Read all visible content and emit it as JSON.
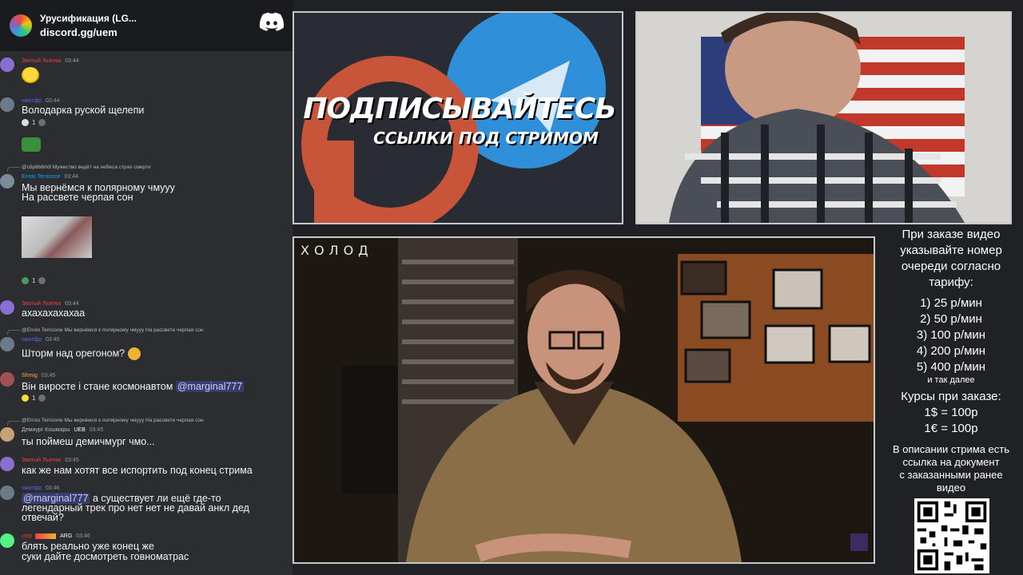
{
  "widget": {
    "server_name": "Урусификация (LG...",
    "invite": "discord.gg/uem"
  },
  "messages": [
    {
      "user": "Звитый Львтюк",
      "time": "03:44",
      "user_color": "#f23f43",
      "body": ""
    },
    {
      "user": "чмотфр",
      "time": "03:44",
      "user_color": "#5865f2",
      "body": "Володарка руской щелепи",
      "reaction_count": "1"
    },
    {
      "reply_text": "@c8p8b8rk8 Мужество ведёт на небеса страх смерти",
      "user": "Ennio Terricone",
      "time": "03:44",
      "user_color": "#00a8fc",
      "body_line1": "Мы вернёмся к полярному чмууу",
      "body_line2": "На рассвете черпая сон",
      "reaction_count": "1"
    },
    {
      "user": "Звитый Львтюк",
      "time": "03:44",
      "user_color": "#f23f43",
      "body": "ахахахахахаа"
    },
    {
      "reply_text": "@Ennio Terricone Мы вернёмся к полярному чмууу На рассвете черпая сон",
      "user": "чмотфр",
      "time": "03:45",
      "user_color": "#5865f2",
      "body": "Шторм над орегоном?"
    },
    {
      "user": "Shmig",
      "time": "03:45",
      "user_color": "#f0b232",
      "body": "Він виросте і стане космонавтом",
      "mention": "@marginal777",
      "reaction_count": "1"
    },
    {
      "reply_text": "@Ennio Terricone Мы вернёмся к полярному чмууу На рассвете черпая сон",
      "user": "Демиург Кошмары",
      "badge": "UEB",
      "time": "03:45",
      "user_color": "#b5bac1",
      "body": "ты поймеш демичмург чмо..."
    },
    {
      "user": "Звитый Львтюк",
      "time": "03:45",
      "user_color": "#f23f43",
      "body": "как же нам хотят все испортить под конец стрима"
    },
    {
      "user": "чмотфр",
      "time": "03:46",
      "user_color": "#5865f2",
      "mention": "@marginal777",
      "body_line1": " а существует ли ещё где-то",
      "body_line2": "легендарный трек про нет нет не давай анкл дед",
      "body_line3": "отвечай?"
    },
    {
      "user": "chtir",
      "badge": "ARG",
      "time": "03:46",
      "user_color": "#f23f43",
      "body_line1": "блять реально уже конец же",
      "body_line2": "суки дайте досмотреть говноматрас"
    }
  ],
  "promo": {
    "line1": "ПОДПИСЫВАЙТЕСЬ",
    "line2": "ССЫЛКИ ПОД СТРИМОМ"
  },
  "video": {
    "brand": "ХОЛОД"
  },
  "info": {
    "lines_top": [
      "При заказе видео",
      "указывайте номер",
      "очереди согласно",
      "тарифу:"
    ],
    "tariffs": [
      "1) 25 р/мин",
      "2) 50 р/мин",
      "3) 100 р/мин",
      "4) 200 р/мин",
      "5) 400 р/мин"
    ],
    "etc": "и так далее",
    "courses_title": "Курсы при заказе:",
    "courses": [
      "1$ = 100р",
      "1€ = 100р"
    ],
    "bottom": [
      "В описании стрима есть",
      "ссылка на документ",
      "с заказанными ранее",
      "видео"
    ]
  },
  "colors": {
    "discord_bg": "#2b2d31",
    "mention_bg": "#5865f2",
    "panel_border": "#c8c8c8",
    "telegram_blue": "#2f8fd8",
    "patreon_red": "#c8553a"
  }
}
